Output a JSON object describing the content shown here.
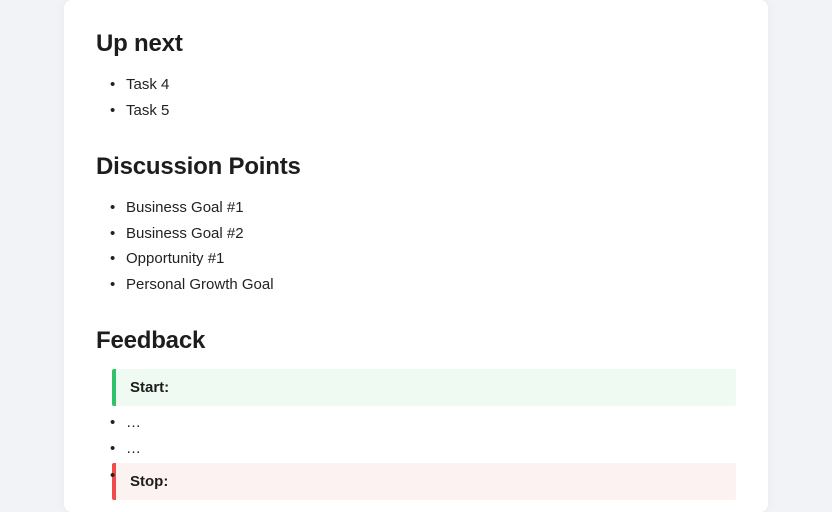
{
  "sections": {
    "up_next": {
      "title": "Up next",
      "items": [
        "Task 4",
        "Task 5"
      ]
    },
    "discussion": {
      "title": "Discussion Points",
      "items": [
        "Business Goal #1",
        "Business Goal #2",
        "Opportunity #1",
        "Personal Growth Goal"
      ]
    },
    "feedback": {
      "title": "Feedback",
      "start_label": "Start:",
      "stop_label": "Stop:",
      "ellipsis": "…",
      "empty": ""
    }
  },
  "colors": {
    "start_accent": "#30c26b",
    "start_bg": "#eefaf2",
    "stop_accent": "#ef4b4b",
    "stop_bg": "#fdf2f2"
  }
}
